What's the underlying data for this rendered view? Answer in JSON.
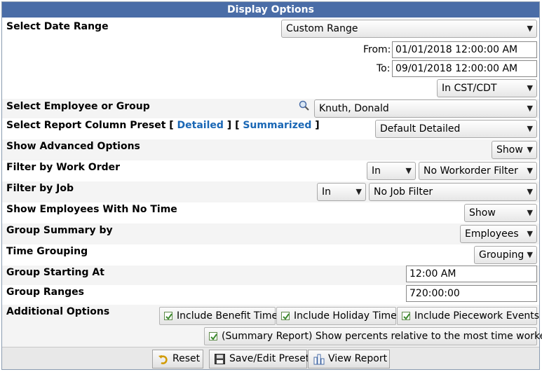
{
  "title": "Display Options",
  "date_range": {
    "label": "Select Date Range",
    "selected": "Custom Range",
    "from_label": "From:",
    "from_value": "01/01/2018 12:00:00 AM",
    "to_label": "To:",
    "to_value": "09/01/2018 12:00:00 AM",
    "timezone": "In CST/CDT"
  },
  "employee": {
    "label": "Select Employee or Group",
    "selected": "Knuth, Donald"
  },
  "column_preset": {
    "label": "Select Report Column Preset",
    "open1": "[",
    "detailed_link": "Detailed",
    "sep": "] [",
    "summarized_link": "Summarized",
    "close": "]",
    "selected": "Default Detailed"
  },
  "advanced": {
    "label": "Show Advanced Options",
    "selected": "Show"
  },
  "work_order": {
    "label": "Filter by Work Order",
    "op": "In",
    "selected": "No Workorder Filter"
  },
  "job": {
    "label": "Filter by Job",
    "op": "In",
    "selected": "No Job Filter"
  },
  "no_time": {
    "label": "Show Employees With No Time",
    "selected": "Show"
  },
  "group_summary": {
    "label": "Group Summary by",
    "selected": "Employees"
  },
  "time_grouping": {
    "label": "Time Grouping",
    "selected": "Grouping"
  },
  "group_start": {
    "label": "Group Starting At",
    "value": "12:00 AM"
  },
  "group_ranges": {
    "label": "Group Ranges",
    "value": "720:00:00"
  },
  "additional": {
    "label": "Additional Options",
    "benefit": "Include Benefit Time",
    "holiday": "Include Holiday Time",
    "piecework": "Include Piecework Events",
    "percents": "(Summary Report) Show percents relative to the most time worked."
  },
  "footer": {
    "reset": "Reset",
    "save_preset": "Save/Edit Preset",
    "view_report": "View Report"
  },
  "colors": {
    "title_bg": "#4a6da7",
    "link": "#1a67b5",
    "check": "#3c8a2e"
  }
}
